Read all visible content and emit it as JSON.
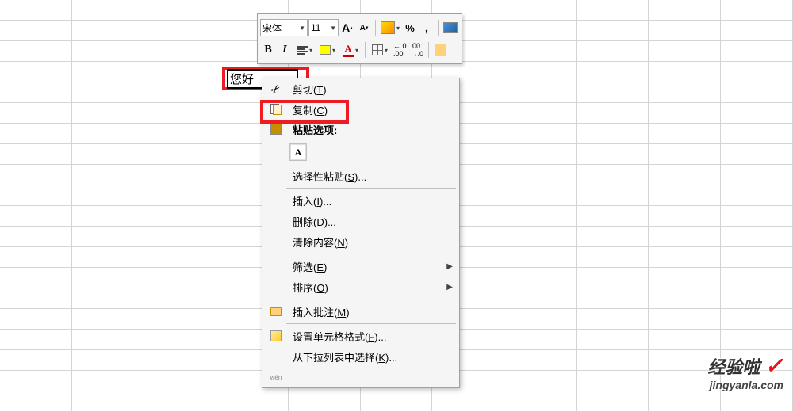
{
  "cell": {
    "text": "您好"
  },
  "toolbar": {
    "font_name": "宋体",
    "font_size": "11",
    "font_grow": "A",
    "font_shrink": "A",
    "percent": "%",
    "comma": ",",
    "bold": "B",
    "italic": "I",
    "font_color_letter": "A",
    "dec_inc": ".00→.0",
    "dec_dec": ".0→.00"
  },
  "menu": {
    "cut": {
      "label": "剪切(",
      "key": "T",
      "suffix": ")"
    },
    "copy": {
      "label": "复制(",
      "key": "C",
      "suffix": ")"
    },
    "paste_options": "粘贴选项:",
    "paste_a": "A",
    "paste_special": {
      "label": "选择性粘贴(",
      "key": "S",
      "suffix": ")..."
    },
    "insert": {
      "label": "插入(",
      "key": "I",
      "suffix": ")..."
    },
    "delete": {
      "label": "删除(",
      "key": "D",
      "suffix": ")..."
    },
    "clear": {
      "label": "清除内容(",
      "key": "N",
      "suffix": ")"
    },
    "filter": {
      "label": "筛选(",
      "key": "E",
      "suffix": ")"
    },
    "sort": {
      "label": "排序(",
      "key": "O",
      "suffix": ")"
    },
    "comment": {
      "label": "插入批注(",
      "key": "M",
      "suffix": ")"
    },
    "format": {
      "label": "设置单元格格式(",
      "key": "F",
      "suffix": ")..."
    },
    "dropdown": {
      "label": "从下拉列表中选择(",
      "key": "K",
      "suffix": ")..."
    },
    "wen_label": "wén"
  },
  "watermark": {
    "brand": "经验啦",
    "check": "✓",
    "url": "jingyanla.com"
  }
}
